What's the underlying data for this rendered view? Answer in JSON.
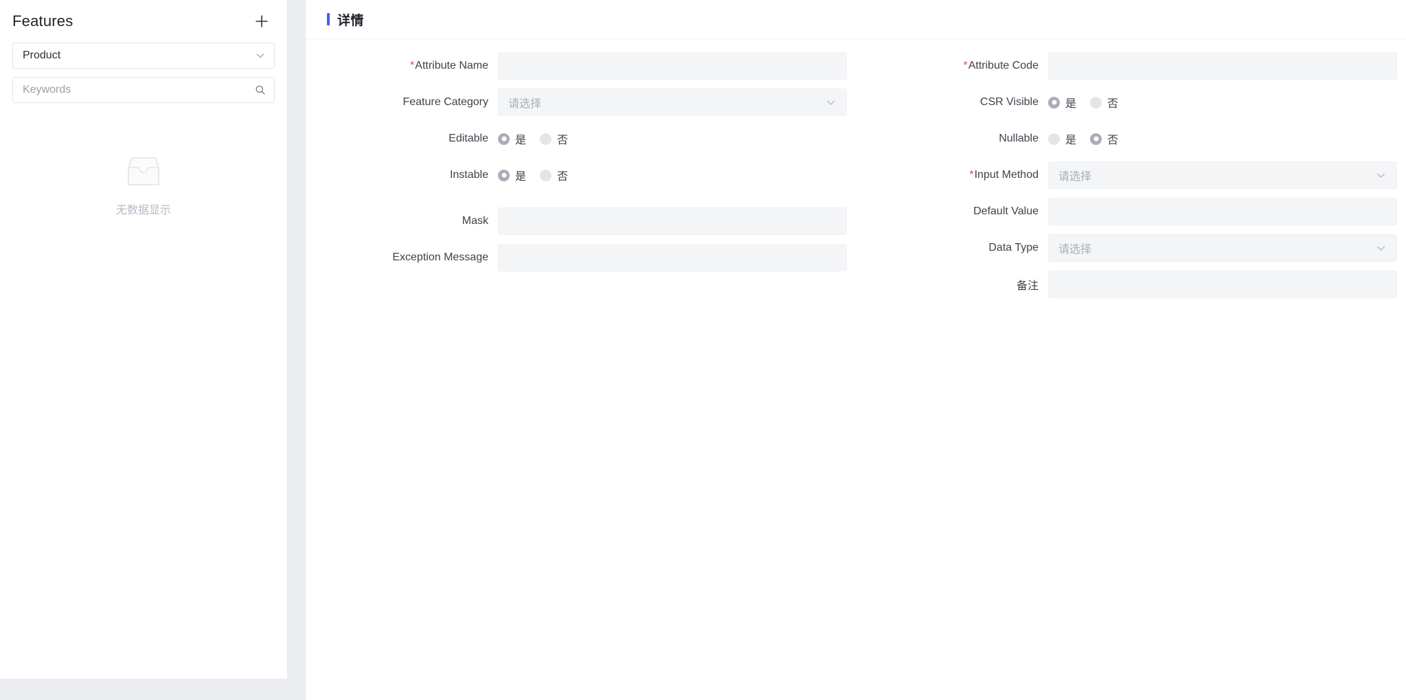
{
  "sidebar": {
    "title": "Features",
    "add_button_label": "+",
    "category_select": {
      "value": "Product",
      "icon": "chevron-down-icon"
    },
    "search": {
      "value": "",
      "placeholder": "Keywords",
      "icon": "search-icon"
    },
    "empty_state": {
      "icon": "inbox-empty-icon",
      "label": "无数据显示"
    }
  },
  "detail": {
    "title": "详情",
    "accent_color": "#3a61f2",
    "required_marker": "*",
    "placeholder_select": "请选择",
    "radio_yes": "是",
    "radio_no": "否",
    "fields": {
      "attribute_name": {
        "label": "Attribute Name",
        "required": true,
        "value": "",
        "type": "input"
      },
      "feature_category": {
        "label": "Feature Category",
        "required": false,
        "value": "请选择",
        "type": "select"
      },
      "editable": {
        "label": "Editable",
        "required": false,
        "type": "radio",
        "selected": "是"
      },
      "instable": {
        "label": "Instable",
        "required": false,
        "type": "radio",
        "selected": "是"
      },
      "mask": {
        "label": "Mask",
        "required": false,
        "value": "",
        "type": "input"
      },
      "exception_message": {
        "label": "Exception Message",
        "required": false,
        "value": "",
        "type": "input"
      },
      "attribute_code": {
        "label": "Attribute Code",
        "required": true,
        "value": "",
        "type": "input"
      },
      "csr_visible": {
        "label": "CSR Visible",
        "required": false,
        "type": "radio",
        "selected": "是"
      },
      "nullable": {
        "label": "Nullable",
        "required": false,
        "type": "radio",
        "selected": "否"
      },
      "input_method": {
        "label": "Input Method",
        "required": true,
        "value": "请选择",
        "type": "select"
      },
      "default_value": {
        "label": "Default Value",
        "required": false,
        "value": "",
        "type": "input"
      },
      "data_type": {
        "label": "Data Type",
        "required": false,
        "value": "请选择",
        "type": "select"
      },
      "remark": {
        "label": "备注",
        "required": false,
        "value": "",
        "type": "input"
      }
    }
  }
}
